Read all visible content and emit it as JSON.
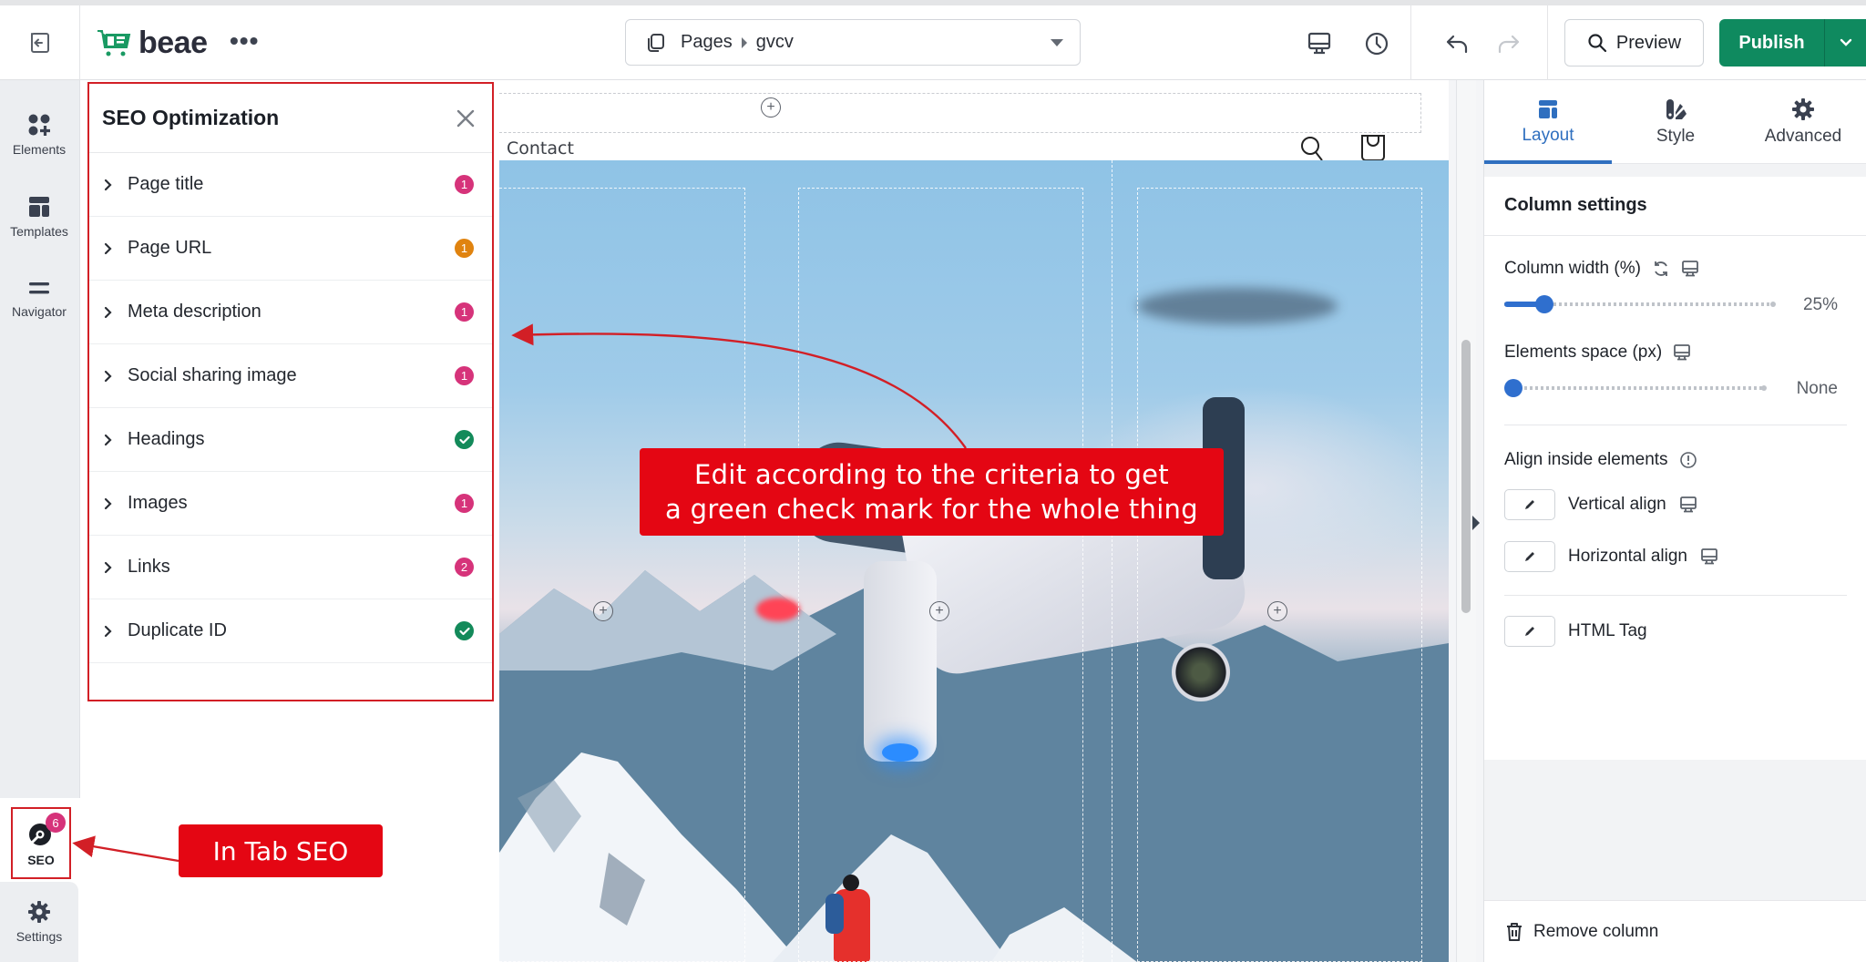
{
  "topbar": {
    "exit_icon": "exit-icon",
    "logo_text": "beae",
    "more_label": "•••",
    "page_selector": {
      "icon": "pages-icon",
      "section": "Pages",
      "page": "gvcv"
    },
    "device_icon": "desktop-icon",
    "history_icon": "clock-icon",
    "undo_icon": "undo-icon",
    "redo_icon": "redo-icon",
    "preview_label": "Preview",
    "publish_label": "Publish",
    "brand_color": "#0f8a5f"
  },
  "rail": {
    "items": [
      {
        "label": "Elements",
        "icon": "elements-icon"
      },
      {
        "label": "Templates",
        "icon": "templates-icon"
      },
      {
        "label": "Navigator",
        "icon": "navigator-icon"
      }
    ],
    "seo": {
      "label": "SEO",
      "badge": "6",
      "icon": "seo-icon"
    },
    "settings": {
      "label": "Settings",
      "icon": "gear-icon"
    }
  },
  "seo_panel": {
    "title": "SEO Optimization",
    "items": [
      {
        "label": "Page title",
        "status": "issue",
        "count": "1",
        "color": "#d6337a"
      },
      {
        "label": "Page URL",
        "status": "warning",
        "count": "1",
        "color": "#e0830f"
      },
      {
        "label": "Meta description",
        "status": "issue",
        "count": "1",
        "color": "#d6337a"
      },
      {
        "label": "Social sharing image",
        "status": "issue",
        "count": "1",
        "color": "#d6337a"
      },
      {
        "label": "Headings",
        "status": "ok",
        "count": "",
        "color": "#138a5a"
      },
      {
        "label": "Images",
        "status": "issue",
        "count": "1",
        "color": "#d6337a"
      },
      {
        "label": "Links",
        "status": "issue",
        "count": "2",
        "color": "#d6337a"
      },
      {
        "label": "Duplicate ID",
        "status": "ok",
        "count": "",
        "color": "#138a5a"
      }
    ]
  },
  "canvas": {
    "nav_link": "Contact",
    "header_icons": [
      "search-icon",
      "cart-icon"
    ],
    "hero_alt": "Drone flying over snowy mountains with hiker"
  },
  "annotations": {
    "main_callout": [
      "Edit according to the criteria to get",
      "a green check mark for the whole thing"
    ],
    "seo_callout": "In Tab SEO",
    "color": "#e40613"
  },
  "right_panel": {
    "tabs": [
      {
        "label": "Layout",
        "icon": "layout-icon",
        "active": true
      },
      {
        "label": "Style",
        "icon": "style-icon",
        "active": false
      },
      {
        "label": "Advanced",
        "icon": "gear-icon",
        "active": false
      }
    ],
    "section_title": "Column settings",
    "column_width": {
      "label": "Column width (%)",
      "value_text": "25%",
      "value": 25
    },
    "elements_space": {
      "label": "Elements space (px)",
      "value_text": "None",
      "value": 0
    },
    "align_title": "Align inside elements",
    "vertical_align": "Vertical align",
    "horizontal_align": "Horizontal align",
    "html_tag": "HTML Tag",
    "remove_column": "Remove column",
    "accent_color": "#2f6fbf"
  }
}
